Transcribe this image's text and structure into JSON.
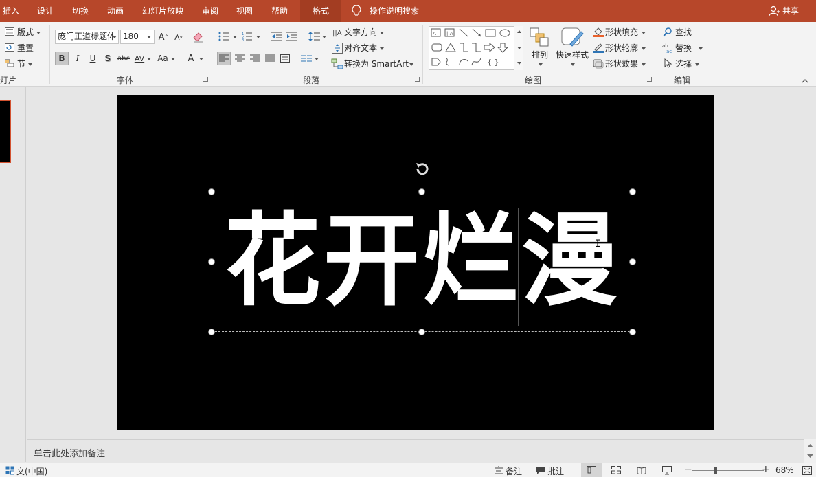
{
  "tabs": [
    {
      "label": "插入"
    },
    {
      "label": "设计"
    },
    {
      "label": "切换"
    },
    {
      "label": "动画"
    },
    {
      "label": "幻灯片放映"
    },
    {
      "label": "审阅"
    },
    {
      "label": "视图"
    },
    {
      "label": "帮助"
    },
    {
      "label": "格式"
    }
  ],
  "tell_me": "操作说明搜索",
  "share": "共享",
  "ribbon": {
    "slides": {
      "layout": "版式",
      "reset": "重置",
      "section": "节",
      "group": "灯片"
    },
    "font": {
      "name": "庞门正道标题体",
      "size": "180",
      "group": "字体",
      "bold": "B",
      "italic": "I",
      "underline": "U",
      "shadow": "S",
      "strike": "abc",
      "spacing": "AV",
      "case": "Aa",
      "color": "A",
      "grow": "A",
      "shrink": "A"
    },
    "paragraph": {
      "text_direction": "文字方向",
      "align_text": "对齐文本",
      "smartart": "转换为 SmartArt",
      "group": "段落"
    },
    "drawing": {
      "arrange": "排列",
      "quick_styles": "快速样式",
      "fill": "形状填充",
      "outline": "形状轮廓",
      "effects": "形状效果",
      "group": "绘图",
      "shapes_row3": "{ }"
    },
    "editing": {
      "find": "查找",
      "replace": "替换",
      "select": "选择",
      "group": "编辑"
    }
  },
  "slide": {
    "title": "花开烂漫"
  },
  "notes": {
    "placeholder": "单击此处添加备注"
  },
  "status": {
    "language": "文(中国)",
    "notes": "备注",
    "comments": "批注",
    "zoom": "68%"
  },
  "colors": {
    "accent": "#b7472a",
    "slide_bg": "#000000",
    "title": "#ffffff"
  }
}
